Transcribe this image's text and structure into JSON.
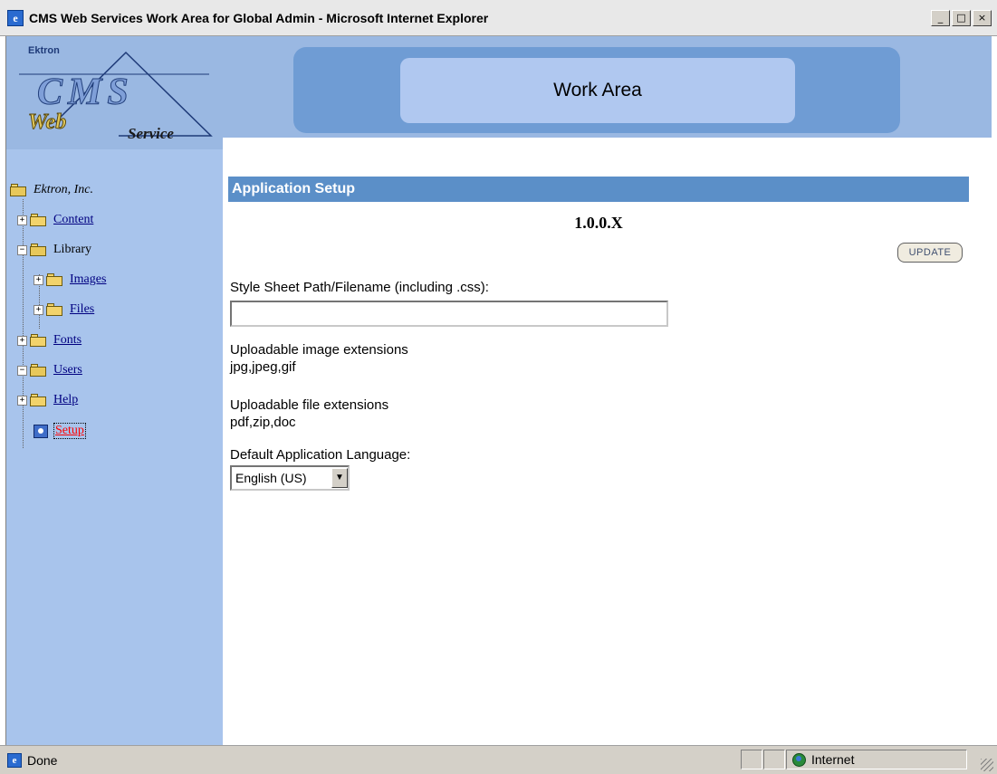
{
  "window": {
    "title": "CMS Web Services Work Area for Global Admin - Microsoft Internet Explorer",
    "controls": {
      "minimize": "_",
      "maximize": "□",
      "close": "×"
    }
  },
  "logo": {
    "company": "Ektron",
    "line1": "CMS",
    "line2": "Web",
    "line3": "Service"
  },
  "header": {
    "title": "Work Area"
  },
  "tree": {
    "root": "Ektron, Inc.",
    "items": [
      {
        "label": "Content",
        "expander": "+"
      },
      {
        "label": "Library",
        "expander": "−"
      },
      {
        "label": "Images",
        "expander": "+"
      },
      {
        "label": "Files",
        "expander": "+"
      },
      {
        "label": "Fonts",
        "expander": "+"
      },
      {
        "label": "Users",
        "expander": "−"
      },
      {
        "label": "Help",
        "expander": "+"
      },
      {
        "label": "Setup"
      }
    ]
  },
  "main": {
    "section_title": "Application Setup",
    "version": "1.0.0.X",
    "update_label": "UPDATE",
    "css_label": "Style Sheet Path/Filename (including .css):",
    "css_value": "",
    "image_ext_label": "Uploadable image extensions",
    "image_ext_value": "jpg,jpeg,gif",
    "file_ext_label": "Uploadable file extensions",
    "file_ext_value": "pdf,zip,doc",
    "language_label": "Default Application Language:",
    "language_value": "English (US)",
    "language_arrow": "▼"
  },
  "status": {
    "text": "Done",
    "zone": "Internet"
  },
  "icons": {
    "app": "ie-icon",
    "status": "ie-page-icon",
    "zone": "globe-icon"
  }
}
